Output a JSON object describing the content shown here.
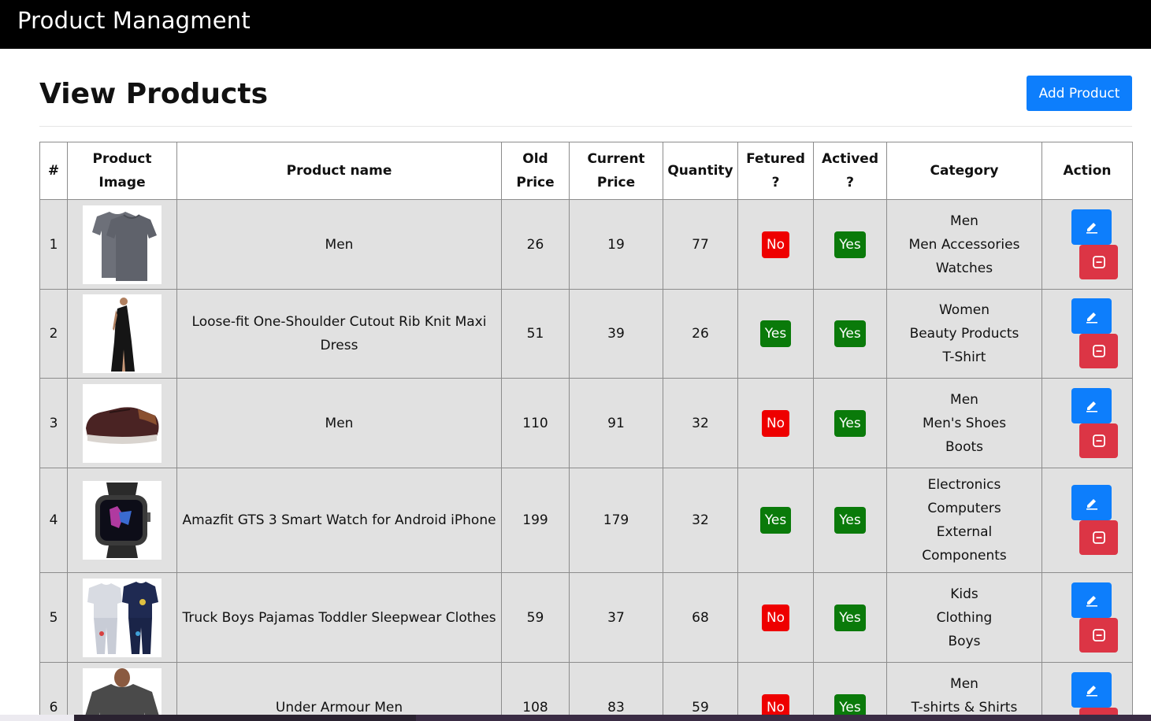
{
  "app": {
    "title": "Product Managment"
  },
  "page": {
    "title": "View Products",
    "add_button_label": "Add Product"
  },
  "table": {
    "headers": {
      "index": "#",
      "image": "Product Image",
      "name": "Product name",
      "old_price": "Old Price",
      "current_price": "Current Price",
      "quantity": "Quantity",
      "featured": "Fetured ?",
      "active": "Actived ?",
      "category": "Category",
      "action": "Action"
    },
    "rows": [
      {
        "index": "1",
        "image": "grey-tshirts-image",
        "name": "Men",
        "old_price": "26",
        "current_price": "19",
        "quantity": "77",
        "featured": "No",
        "active": "Yes",
        "category": [
          "Men",
          "Men Accessories",
          "Watches"
        ]
      },
      {
        "index": "2",
        "image": "black-dress-image",
        "name": "Loose-fit One-Shoulder Cutout Rib Knit Maxi Dress",
        "old_price": "51",
        "current_price": "39",
        "quantity": "26",
        "featured": "Yes",
        "active": "Yes",
        "category": [
          "Women",
          "Beauty Products",
          "T-Shirt"
        ]
      },
      {
        "index": "3",
        "image": "brown-sneaker-image",
        "name": "Men",
        "old_price": "110",
        "current_price": "91",
        "quantity": "32",
        "featured": "No",
        "active": "Yes",
        "category": [
          "Men",
          "Men's Shoes",
          "Boots"
        ]
      },
      {
        "index": "4",
        "image": "smart-watch-image",
        "name": "Amazfit GTS 3 Smart Watch for Android iPhone",
        "old_price": "199",
        "current_price": "179",
        "quantity": "32",
        "featured": "Yes",
        "active": "Yes",
        "category": [
          "Electronics",
          "Computers",
          "External",
          "Components"
        ]
      },
      {
        "index": "5",
        "image": "kids-pajamas-image",
        "name": "Truck Boys Pajamas Toddler Sleepwear Clothes",
        "old_price": "59",
        "current_price": "37",
        "quantity": "68",
        "featured": "No",
        "active": "Yes",
        "category": [
          "Kids",
          "Clothing",
          "Boys"
        ]
      },
      {
        "index": "6",
        "image": "man-tshirt-image",
        "name": "Under Armour Men",
        "old_price": "108",
        "current_price": "83",
        "quantity": "59",
        "featured": "No",
        "active": "Yes",
        "category": [
          "Men",
          "T-shirts & Shirts"
        ]
      }
    ]
  },
  "colors": {
    "topbar": "#000000",
    "primary": "#0d7efc",
    "danger": "#dc3545",
    "badge_no": "#ee0000",
    "badge_yes": "#0a7a0a",
    "row_bg": "#e1e1e1"
  },
  "icons": {
    "edit": "pencil-icon",
    "delete": "minus-square-icon"
  }
}
